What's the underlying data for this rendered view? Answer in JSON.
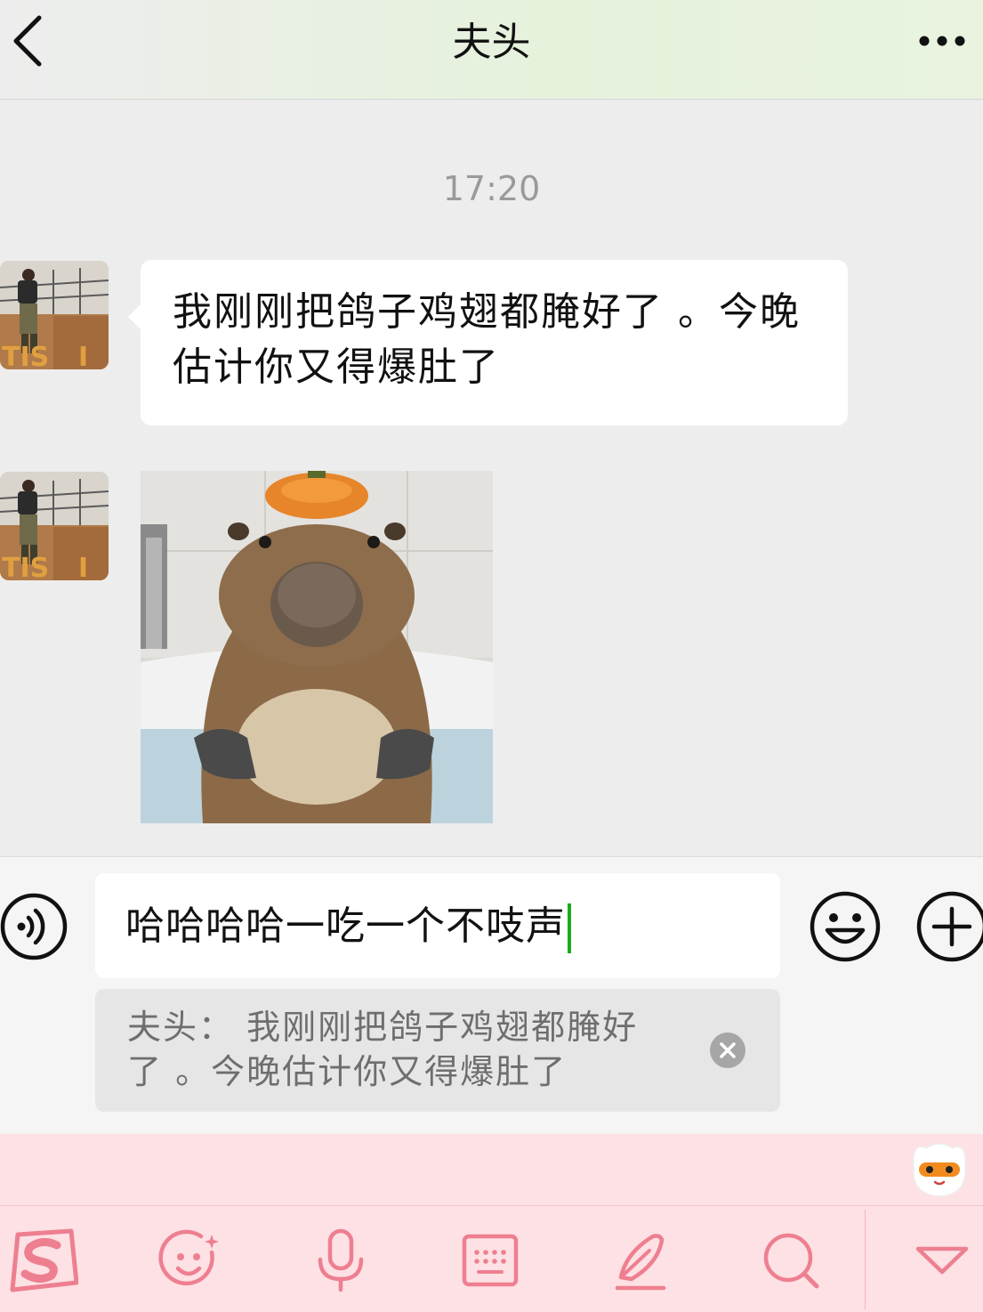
{
  "header": {
    "title": "夫头",
    "back_icon": "chevron-left-icon",
    "more_icon": "more-dots-icon"
  },
  "chat": {
    "timestamp": "17:20",
    "messages": [
      {
        "type": "text",
        "sender_avatar": "avatar-photo",
        "text": "我刚刚把鸽子鸡翅都腌好了 。今晚估计你又得爆肚了"
      },
      {
        "type": "sticker",
        "sender_avatar": "avatar-photo",
        "sticker": "capybara-in-bathtub-with-orange-on-head"
      }
    ]
  },
  "input": {
    "value": "哈哈哈哈一吃一个不吱声",
    "voice_icon": "voice-icon",
    "emoji_icon": "emoji-icon",
    "plus_icon": "plus-icon",
    "quote": {
      "text": "夫头： 我刚刚把鸽子鸡翅都腌好了 。今晚估计你又得爆肚了",
      "close_icon": "close-circle-icon"
    }
  },
  "keyboard": {
    "mascot_icon": "ime-mascot-icon",
    "toolbar_icons": [
      "sogou-logo-icon",
      "emoji-face-icon",
      "microphone-icon",
      "keyboard-icon",
      "handwriting-pen-icon",
      "search-icon",
      "collapse-triangle-icon"
    ],
    "accent_color": "#f08a98"
  },
  "colors": {
    "chat_bg": "#ededed",
    "bubble_bg": "#ffffff",
    "caret": "#1aad19",
    "ime_bg": "#fde1e4"
  }
}
